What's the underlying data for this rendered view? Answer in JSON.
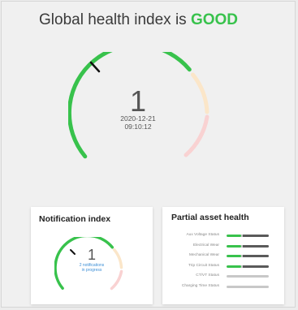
{
  "headline": {
    "text": "Global health index is",
    "status": "GOOD",
    "status_color": "#38c24c"
  },
  "main_gauge": {
    "value": "1",
    "date": "2020-12-21",
    "time": "09:10:12",
    "colors": {
      "good": "#38c24c",
      "warning": "#fbe6c9",
      "critical": "#f9d2d2",
      "marker": "#111111"
    }
  },
  "notification_card": {
    "title": "Notification index",
    "value": "1",
    "note_line1": "2 notifications",
    "note_line2": "in progress"
  },
  "partial_card": {
    "title": "Partial asset health",
    "rows": [
      {
        "label": "Aux Voltage Status",
        "status": "good"
      },
      {
        "label": "Electrical Wear",
        "status": "good"
      },
      {
        "label": "Mechanical Wear",
        "status": "good"
      },
      {
        "label": "Trip Circuit Status",
        "status": "good"
      },
      {
        "label": "CT/VT Status",
        "status": "none"
      },
      {
        "label": "Charging Time Status",
        "status": "none"
      }
    ]
  }
}
